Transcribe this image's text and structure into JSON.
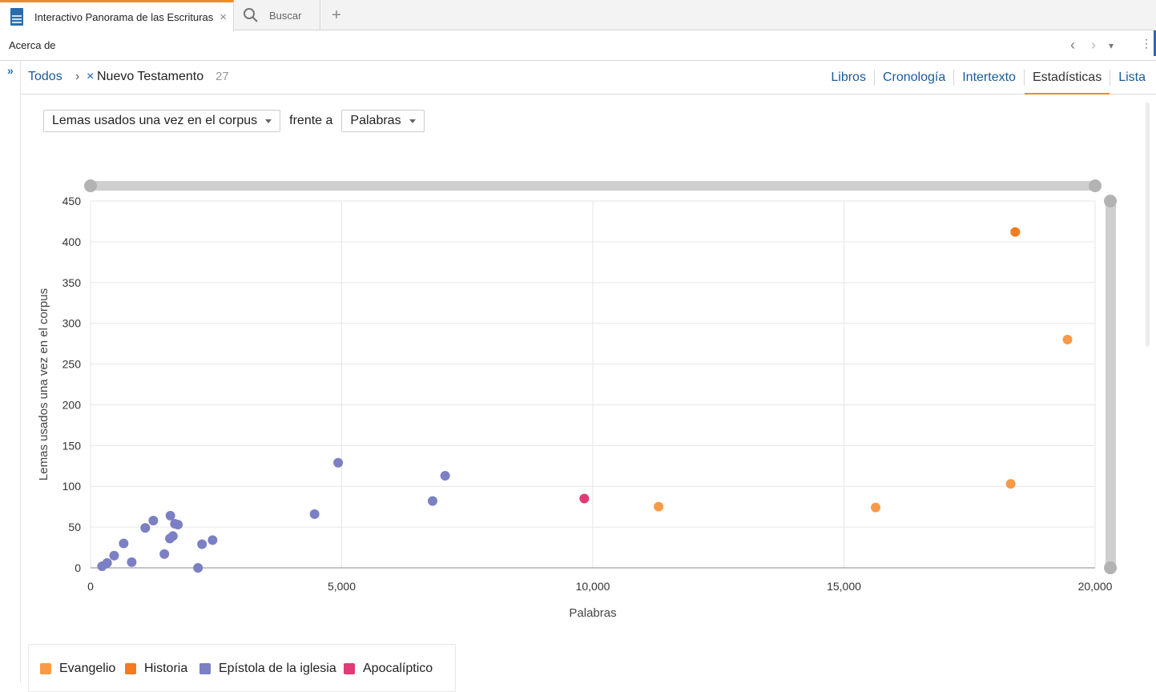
{
  "tabs": {
    "active_title": "Interactivo Panorama de las Escrituras",
    "search_label": "Buscar",
    "close_glyph": "×",
    "new_tab_glyph": "+"
  },
  "toolbar": {
    "about_label": "Acerca de",
    "back_glyph": "‹",
    "forward_glyph": "›",
    "dropdown_glyph": "▾",
    "menu_glyph": "⋮"
  },
  "sidebar": {
    "expand_glyph": "»"
  },
  "breadcrumb": {
    "root": "Todos",
    "separator": "›",
    "remove_glyph": "×",
    "current": "Nuevo Testamento",
    "count": "27"
  },
  "view_tabs": [
    "Libros",
    "Cronología",
    "Intertexto",
    "Estadísticas",
    "Lista"
  ],
  "active_view": "Estadísticas",
  "controls": {
    "y_metric": "Lemas usados una vez en el corpus",
    "versus_label": "frente a",
    "x_metric": "Palabras"
  },
  "colors": {
    "accent": "#f08a24",
    "link": "#1a5a9c",
    "evangelio": "#f99a47",
    "historia": "#f47b20",
    "epistola": "#7b80c4",
    "apocaliptico": "#e03a77"
  },
  "chart_data": {
    "type": "scatter",
    "xlabel": "Palabras",
    "ylabel": "Lemas usados una vez en el corpus",
    "xlim": [
      0,
      20000
    ],
    "ylim": [
      0,
      450
    ],
    "x_ticks": [
      "0",
      "5,000",
      "10,000",
      "15,000",
      "20,000"
    ],
    "y_ticks": [
      "0",
      "50",
      "100",
      "150",
      "200",
      "250",
      "300",
      "350",
      "400",
      "450"
    ],
    "grid": true,
    "legend_position": "bottom-left",
    "series": [
      {
        "name": "Evangelio",
        "color": "#f99a47",
        "points": [
          [
            19450,
            280
          ],
          [
            18320,
            103
          ],
          [
            15630,
            74
          ],
          [
            11310,
            75
          ]
        ]
      },
      {
        "name": "Historia",
        "color": "#f47b20",
        "points": [
          [
            18410,
            412
          ]
        ]
      },
      {
        "name": "Epístola de la iglesia",
        "color": "#7b80c4",
        "points": [
          [
            4930,
            129
          ],
          [
            7060,
            113
          ],
          [
            6810,
            82
          ],
          [
            4460,
            66
          ],
          [
            1590,
            64
          ],
          [
            1250,
            58
          ],
          [
            1680,
            54
          ],
          [
            1740,
            53
          ],
          [
            1090,
            49
          ],
          [
            1640,
            39
          ],
          [
            1580,
            36
          ],
          [
            2430,
            34
          ],
          [
            660,
            30
          ],
          [
            2220,
            29
          ],
          [
            1470,
            17
          ],
          [
            470,
            15
          ],
          [
            820,
            7
          ],
          [
            330,
            6
          ],
          [
            230,
            2
          ],
          [
            2140,
            0
          ]
        ]
      },
      {
        "name": "Apocalíptico",
        "color": "#e03a77",
        "points": [
          [
            9830,
            85
          ]
        ]
      }
    ]
  }
}
